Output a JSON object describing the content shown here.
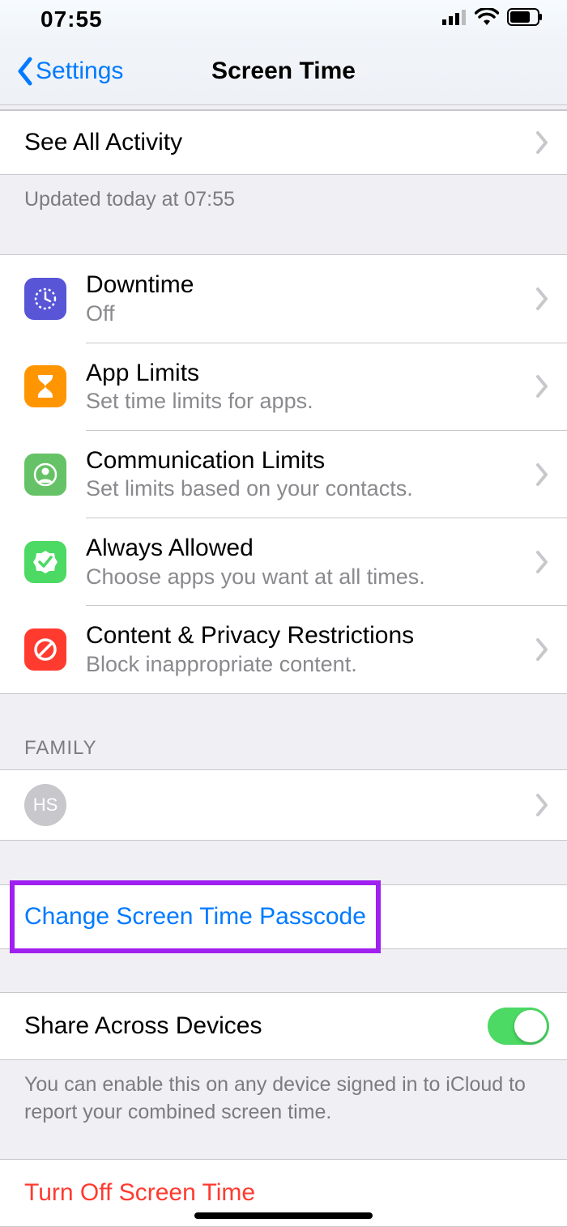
{
  "status": {
    "time": "07:55"
  },
  "nav": {
    "back": "Settings",
    "title": "Screen Time"
  },
  "activity": {
    "see_all": "See All Activity",
    "updated": "Updated today at 07:55"
  },
  "options": [
    {
      "title": "Downtime",
      "sub": "Off",
      "color": "#5856d6",
      "icon": "clock"
    },
    {
      "title": "App Limits",
      "sub": "Set time limits for apps.",
      "color": "#ff9500",
      "icon": "hourglass"
    },
    {
      "title": "Communication Limits",
      "sub": "Set limits based on your contacts.",
      "color": "#66c266",
      "icon": "contact"
    },
    {
      "title": "Always Allowed",
      "sub": "Choose apps you want at all times.",
      "color": "#4cd964",
      "icon": "check"
    },
    {
      "title": "Content & Privacy Restrictions",
      "sub": "Block inappropriate content.",
      "color": "#ff3b30",
      "icon": "block"
    }
  ],
  "family": {
    "header": "FAMILY",
    "avatar_initials": "HS"
  },
  "passcode": {
    "label": "Change Screen Time Passcode"
  },
  "share": {
    "label": "Share Across Devices",
    "footer": "You can enable this on any device signed in to iCloud to report your combined screen time."
  },
  "turnoff": {
    "label": "Turn Off Screen Time"
  }
}
